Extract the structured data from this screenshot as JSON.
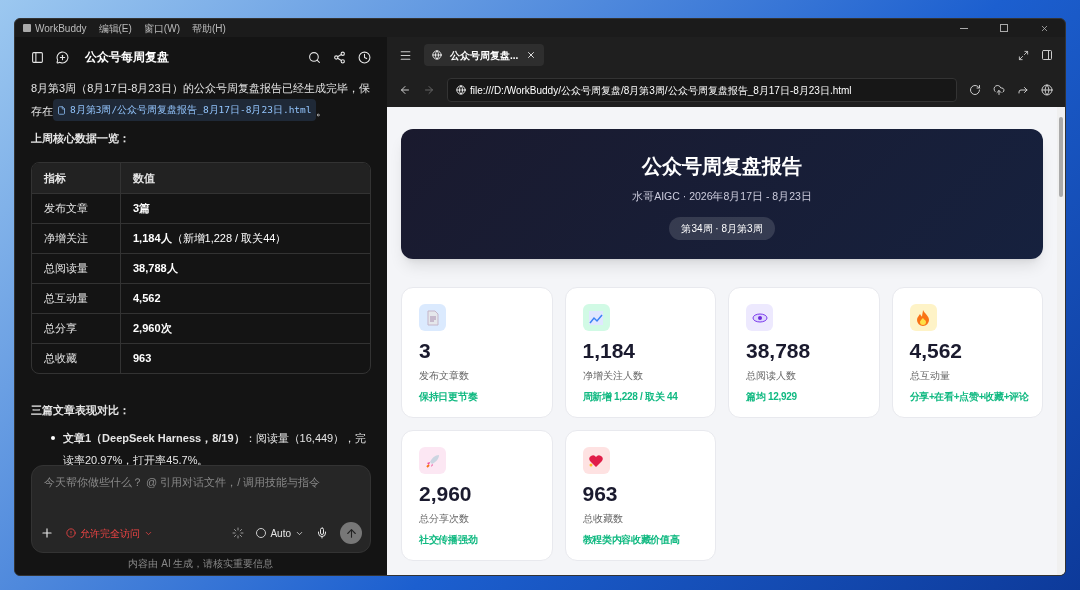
{
  "app": {
    "name": "WorkBuddy",
    "menu": [
      "编辑(E)",
      "窗口(W)",
      "帮助(H)"
    ]
  },
  "chat": {
    "title": "公众号每周复盘",
    "intro": "8月第3周（8月17日-8月23日）的公众号周复盘报告已经生成完毕，保存在",
    "file_link": "8月第3周/公众号周复盘报告_8月17日-8月23日.html",
    "intro_end": "。",
    "table_heading": "上周核心数据一览：",
    "table": {
      "columns": [
        "指标",
        "数值"
      ],
      "rows": [
        {
          "label": "发布文章",
          "value": "**3篇**"
        },
        {
          "label": "净增关注",
          "value": "**1,184人**（新增1,228 / 取关44）"
        },
        {
          "label": "总阅读量",
          "value": "**38,788人**"
        },
        {
          "label": "总互动量",
          "value": "**4,562**"
        },
        {
          "label": "总分享",
          "value": "**2,960次**"
        },
        {
          "label": "总收藏",
          "value": "**963**"
        }
      ]
    },
    "compare_heading": "三篇文章表现对比：",
    "bullets": [
      "**文章1（DeepSeek Harness，8/19）**：阅读量（16,449），完读率20.97%，打开率45.7%。"
    ],
    "input": {
      "placeholder": "今天帮你做些什么？ @ 引用对话文件，/ 调用技能与指令",
      "access": "允许完全访问",
      "model": "Auto"
    },
    "disclaimer": "内容由 AI 生成，请核实重要信息"
  },
  "browser": {
    "tab": {
      "title": "公众号周复盘...",
      "selected": true
    },
    "url": "file:///D:/WorkBuddy/公众号周复盘/8月第3周/公众号周复盘报告_8月17日-8月23日.html",
    "report": {
      "title": "公众号周复盘报告",
      "subtitle": "水哥AIGC · 2026年8月17日 - 8月23日",
      "badge": "第34周 · 8月第3周",
      "cards": [
        {
          "kind": "doc",
          "color": "#dbeafe",
          "value": "3",
          "label": "发布文章数",
          "note": "保持日更节奏"
        },
        {
          "kind": "chart",
          "color": "#d1fae5",
          "value": "1,184",
          "label": "净增关注人数",
          "note": "周新增 1,228 / 取关 44"
        },
        {
          "kind": "eye",
          "color": "#ede9fe",
          "value": "38,788",
          "label": "总阅读人数",
          "note": "篇均 12,929"
        },
        {
          "kind": "fire",
          "color": "#fef3c7",
          "value": "4,562",
          "label": "总互动量",
          "note": "分享+在看+点赞+收藏+评论"
        },
        {
          "kind": "rocket",
          "color": "#fce7f3",
          "value": "2,960",
          "label": "总分享次数",
          "note": "社交传播强劲"
        },
        {
          "kind": "heart",
          "color": "#fee2e2",
          "value": "963",
          "label": "总收藏数",
          "note": "教程类内容收藏价值高"
        }
      ]
    }
  }
}
